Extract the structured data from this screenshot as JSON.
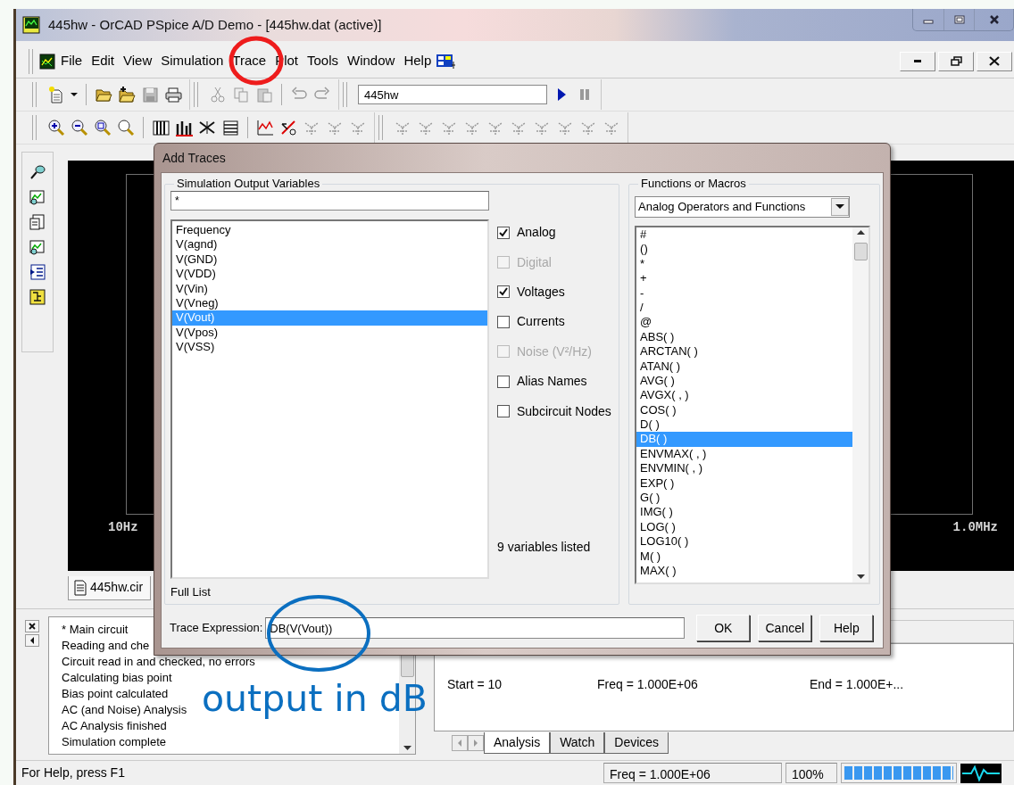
{
  "window": {
    "title": "445hw - OrCAD PSpice A/D Demo - [445hw.dat (active)]"
  },
  "menu": [
    "File",
    "Edit",
    "View",
    "Simulation",
    "Trace",
    "Plot",
    "Tools",
    "Window",
    "Help"
  ],
  "toolbar": {
    "simulation_profile": "445hw"
  },
  "plot": {
    "x_start_label": "10Hz",
    "x_end_label": "1.0MHz"
  },
  "document_tabs": [
    {
      "label": "445hw.cir",
      "selected": true
    }
  ],
  "output_log": [
    "* Main circuit",
    "Reading and che",
    "Circuit read in and checked, no errors",
    "Calculating bias point",
    "Bias point calculated",
    "AC (and Noise) Analysis",
    "AC Analysis finished",
    "Simulation complete"
  ],
  "analysis_panel": {
    "fields": [
      "Start =  10",
      "Freq =  1.000E+06",
      "End =  1.000E+..."
    ],
    "tabs": [
      {
        "label": "Analysis",
        "selected": true
      },
      {
        "label": "Watch",
        "selected": false
      },
      {
        "label": "Devices",
        "selected": false
      }
    ]
  },
  "status_bar": {
    "help": "For Help, press F1",
    "frequency": "Freq =  1.000E+06",
    "zoom": "100%",
    "progress": {
      "level": 1
    }
  },
  "dialog": {
    "title": "Add Traces",
    "variables_group": {
      "title": "Simulation Output Variables",
      "filter": "*",
      "items": [
        {
          "label": "Frequency",
          "selected": false
        },
        {
          "label": "V(agnd)",
          "selected": false
        },
        {
          "label": "V(GND)",
          "selected": false
        },
        {
          "label": "V(VDD)",
          "selected": false
        },
        {
          "label": "V(Vin)",
          "selected": false
        },
        {
          "label": "V(Vneg)",
          "selected": false
        },
        {
          "label": "V(Vout)",
          "selected": true
        },
        {
          "label": "V(Vpos)",
          "selected": false
        },
        {
          "label": "V(VSS)",
          "selected": false
        }
      ],
      "options": [
        {
          "label": "Analog",
          "checked": true,
          "disabled": false
        },
        {
          "label": "Digital",
          "checked": false,
          "disabled": true
        },
        {
          "label": "Voltages",
          "checked": true,
          "disabled": false
        },
        {
          "label": "Currents",
          "checked": false,
          "disabled": false
        },
        {
          "label": "Noise (V²/Hz)",
          "checked": false,
          "disabled": true
        },
        {
          "label": "Alias Names",
          "checked": false,
          "disabled": false
        },
        {
          "label": "Subcircuit Nodes",
          "checked": false,
          "disabled": false
        }
      ],
      "count": "9 variables listed",
      "list_caption": "Full List"
    },
    "functions_group": {
      "title": "Functions or Macros",
      "category": "Analog Operators and Functions",
      "items": [
        {
          "label": "#",
          "selected": false
        },
        {
          "label": "()",
          "selected": false
        },
        {
          "label": "*",
          "selected": false
        },
        {
          "label": "+",
          "selected": false
        },
        {
          "label": "-",
          "selected": false
        },
        {
          "label": "/",
          "selected": false
        },
        {
          "label": "@",
          "selected": false
        },
        {
          "label": "ABS( )",
          "selected": false
        },
        {
          "label": "ARCTAN( )",
          "selected": false
        },
        {
          "label": "ATAN( )",
          "selected": false
        },
        {
          "label": "AVG( )",
          "selected": false
        },
        {
          "label": "AVGX( , )",
          "selected": false
        },
        {
          "label": "COS( )",
          "selected": false
        },
        {
          "label": "D( )",
          "selected": false
        },
        {
          "label": "DB( )",
          "selected": true
        },
        {
          "label": "ENVMAX( , )",
          "selected": false
        },
        {
          "label": "ENVMIN( , )",
          "selected": false
        },
        {
          "label": "EXP( )",
          "selected": false
        },
        {
          "label": "G( )",
          "selected": false
        },
        {
          "label": "IMG( )",
          "selected": false
        },
        {
          "label": "LOG( )",
          "selected": false
        },
        {
          "label": "LOG10( )",
          "selected": false
        },
        {
          "label": "M( )",
          "selected": false
        },
        {
          "label": "MAX( )",
          "selected": false
        }
      ]
    },
    "trace_expression": {
      "label": "Trace Expression:",
      "value": "DB(V(Vout))"
    },
    "buttons": [
      "OK",
      "Cancel",
      "Help"
    ]
  },
  "annotations": [
    {
      "kind": "circle",
      "color": "#ee1c1c"
    },
    {
      "kind": "ellipse",
      "color": "#0b6fc0"
    },
    {
      "kind": "label",
      "text": "output in dB",
      "color": "#0b6fc0"
    }
  ]
}
